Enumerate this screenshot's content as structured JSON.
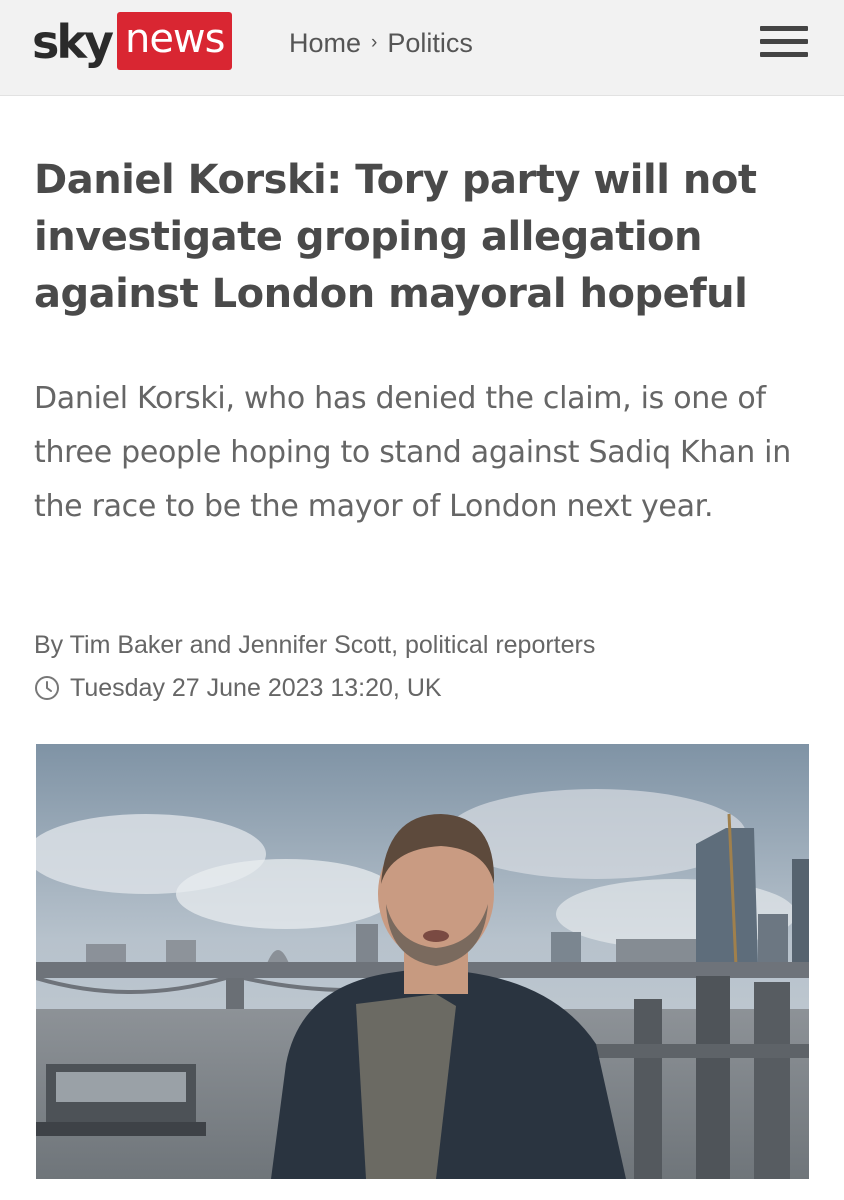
{
  "header": {
    "logo": {
      "sky": "sky",
      "news": "news"
    },
    "breadcrumb": {
      "home": "Home",
      "separator": "›",
      "section": "Politics"
    },
    "menu_icon": "hamburger-menu-icon"
  },
  "article": {
    "headline": "Daniel Korski: Tory party will not investigate groping allegation against London mayoral hopeful",
    "standfirst": "Daniel Korski, who has denied the claim, is one of three people hoping to stand against Sadiq Khan in the race to be the mayor of London next year.",
    "byline": "By Tim Baker and Jennifer Scott, political reporters",
    "timestamp": "Tuesday 27 June 2023 13:20, UK",
    "clock_icon": "clock-icon"
  },
  "colors": {
    "brand_red": "#d92632",
    "header_bg": "#f2f2f2",
    "headline_text": "#4a4a4a",
    "body_text": "#666666"
  }
}
